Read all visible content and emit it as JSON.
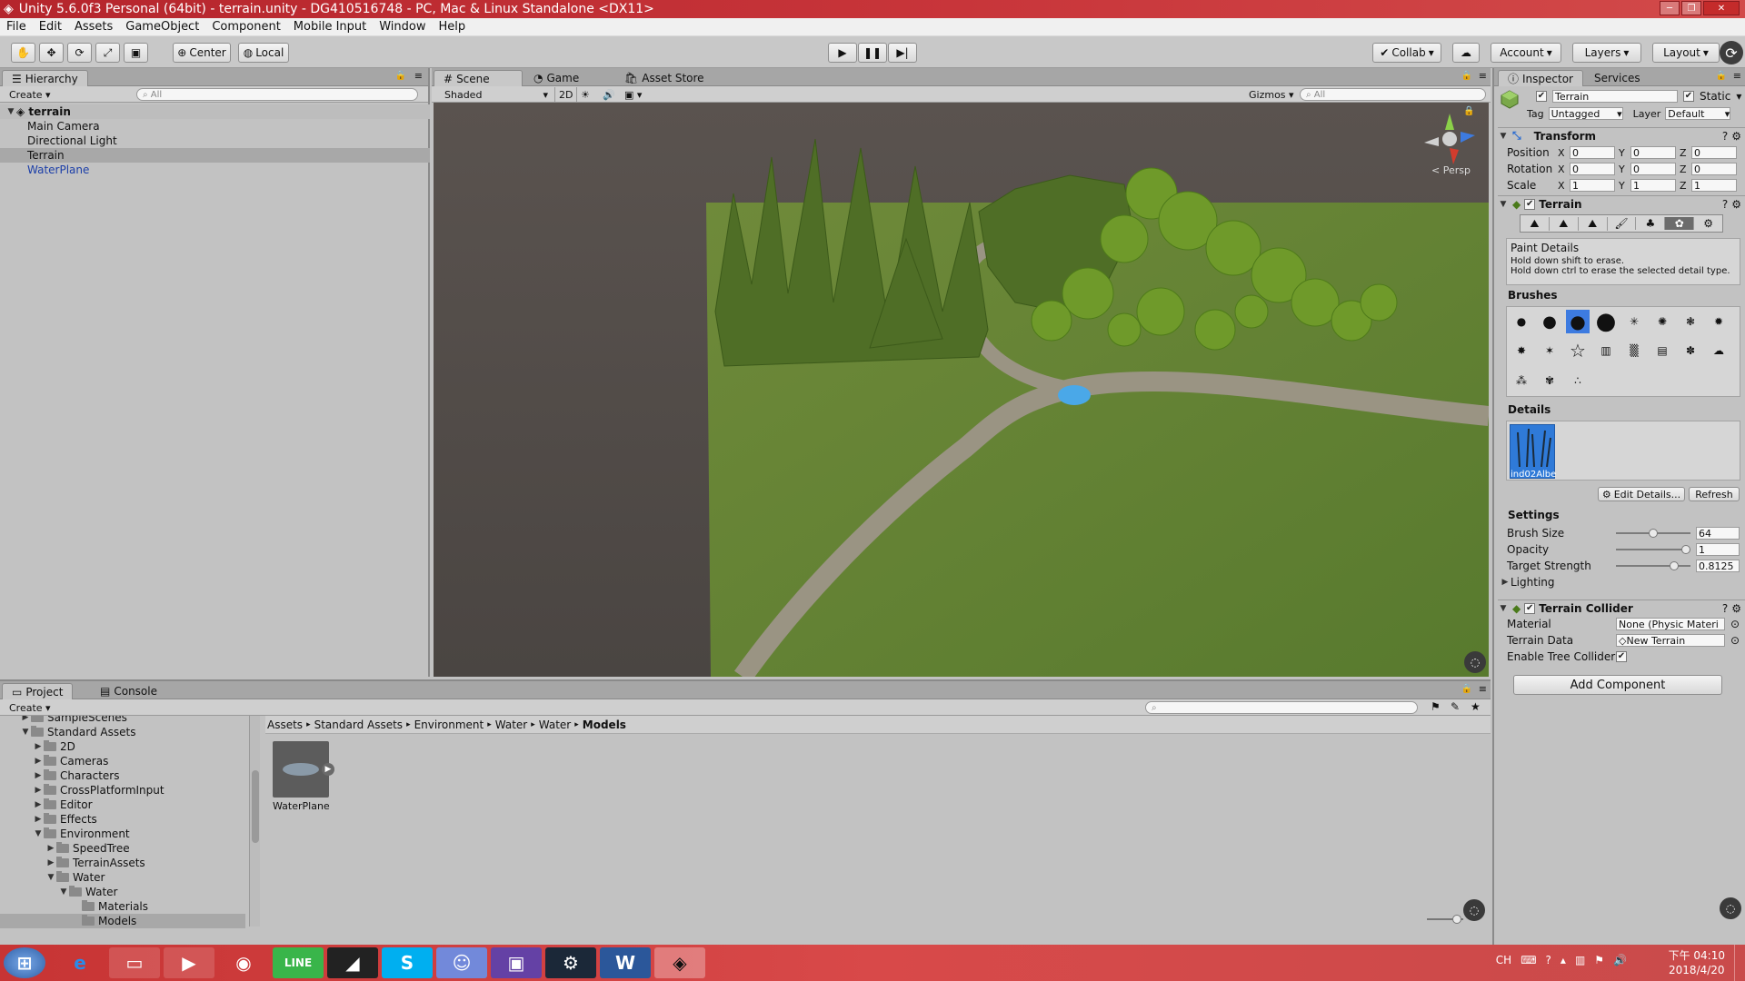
{
  "window": {
    "title": "Unity 5.6.0f3 Personal (64bit) - terrain.unity - DG410516748 - PC, Mac & Linux Standalone <DX11>"
  },
  "menu": [
    "File",
    "Edit",
    "Assets",
    "GameObject",
    "Component",
    "Mobile Input",
    "Window",
    "Help"
  ],
  "toolbar": {
    "center": "Center",
    "local": "Local",
    "collab": "Collab",
    "account": "Account",
    "layers": "Layers",
    "layout": "Layout"
  },
  "hierarchy": {
    "tab": "Hierarchy",
    "create": "Create",
    "search_placeholder": "All",
    "scene": "terrain",
    "items": [
      "Main Camera",
      "Directional Light",
      "Terrain",
      "WaterPlane"
    ]
  },
  "scene": {
    "tabs": [
      "Scene",
      "Game",
      "Asset Store"
    ],
    "shading": "Shaded",
    "mode_2d": "2D",
    "gizmos": "Gizmos",
    "search_placeholder": "All",
    "persp": "Persp"
  },
  "inspector": {
    "tabs": [
      "Inspector",
      "Services"
    ],
    "object_name": "Terrain",
    "static": "Static",
    "tag_label": "Tag",
    "tag": "Untagged",
    "layer_label": "Layer",
    "layer": "Default",
    "transform": {
      "title": "Transform",
      "position": {
        "label": "Position",
        "x": "0",
        "y": "0",
        "z": "0"
      },
      "rotation": {
        "label": "Rotation",
        "x": "0",
        "y": "0",
        "z": "0"
      },
      "scale": {
        "label": "Scale",
        "x": "1",
        "y": "1",
        "z": "1"
      }
    },
    "terrain": {
      "title": "Terrain",
      "paint_title": "Paint Details",
      "hint1": "Hold down shift to erase.",
      "hint2": "Hold down ctrl to erase the selected detail type.",
      "brushes_label": "Brushes",
      "details_label": "Details",
      "detail_item": "ind02Albe",
      "edit_details": "Edit Details...",
      "refresh": "Refresh",
      "settings": "Settings",
      "brush_size": {
        "label": "Brush Size",
        "value": "64",
        "fraction": 0.5
      },
      "opacity": {
        "label": "Opacity",
        "value": "1",
        "fraction": 1
      },
      "target_strength": {
        "label": "Target Strength",
        "value": "0.8125",
        "fraction": 0.8125
      },
      "lighting": "Lighting"
    },
    "collider": {
      "title": "Terrain Collider",
      "material_label": "Material",
      "material": "None (Physic Materi",
      "data_label": "Terrain Data",
      "data": "New Terrain",
      "tree_label": "Enable Tree Collider"
    },
    "add_component": "Add Component"
  },
  "project": {
    "tabs": [
      "Project",
      "Console"
    ],
    "create": "Create",
    "tree": [
      {
        "label": "SampleScenes",
        "depth": 1,
        "open": false
      },
      {
        "label": "Standard Assets",
        "depth": 1,
        "open": true
      },
      {
        "label": "2D",
        "depth": 2,
        "open": false
      },
      {
        "label": "Cameras",
        "depth": 2,
        "open": false
      },
      {
        "label": "Characters",
        "depth": 2,
        "open": false
      },
      {
        "label": "CrossPlatformInput",
        "depth": 2,
        "open": false
      },
      {
        "label": "Editor",
        "depth": 2,
        "open": false
      },
      {
        "label": "Effects",
        "depth": 2,
        "open": false
      },
      {
        "label": "Environment",
        "depth": 2,
        "open": true
      },
      {
        "label": "SpeedTree",
        "depth": 3,
        "open": false
      },
      {
        "label": "TerrainAssets",
        "depth": 3,
        "open": false
      },
      {
        "label": "Water",
        "depth": 3,
        "open": true
      },
      {
        "label": "Water",
        "depth": 4,
        "open": true
      },
      {
        "label": "Materials",
        "depth": 5,
        "open": null
      },
      {
        "label": "Models",
        "depth": 5,
        "open": null
      }
    ],
    "breadcrumb": [
      "Assets",
      "Standard Assets",
      "Environment",
      "Water",
      "Water",
      "Models"
    ],
    "asset": "WaterPlane"
  },
  "taskbar": {
    "lang": "CH",
    "time": "下午 04:10",
    "date": "2018/4/20"
  }
}
